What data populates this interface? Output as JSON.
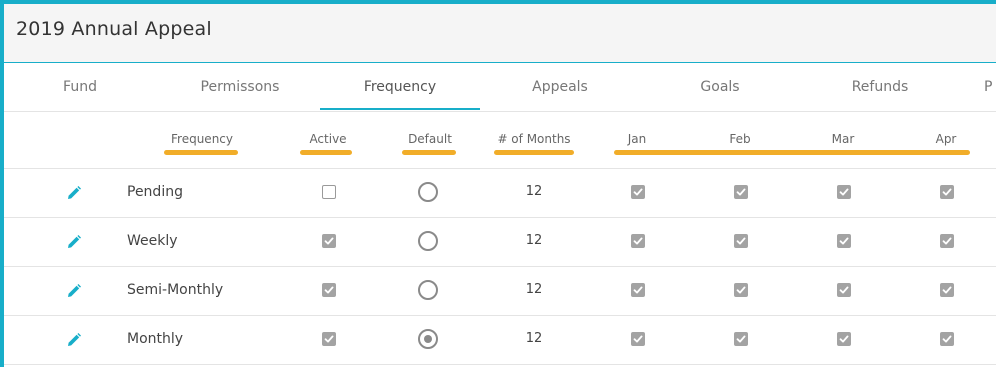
{
  "window": {
    "title": "2019 Annual Appeal"
  },
  "tabs": [
    {
      "label": "Fund"
    },
    {
      "label": "Permissons"
    },
    {
      "label": "Frequency",
      "active": true
    },
    {
      "label": "Appeals"
    },
    {
      "label": "Goals"
    },
    {
      "label": "Refunds"
    },
    {
      "label": "P"
    }
  ],
  "table": {
    "headers": {
      "frequency": "Frequency",
      "active": "Active",
      "default": "Default",
      "months": "# of Months",
      "jan": "Jan",
      "feb": "Feb",
      "mar": "Mar",
      "apr": "Apr"
    },
    "rows": [
      {
        "name": "Pending",
        "active": false,
        "default": false,
        "months": "12",
        "jan": true,
        "feb": true,
        "mar": true,
        "apr": true
      },
      {
        "name": "Weekly",
        "active": true,
        "default": false,
        "months": "12",
        "jan": true,
        "feb": true,
        "mar": true,
        "apr": true
      },
      {
        "name": "Semi-Monthly",
        "active": true,
        "default": false,
        "months": "12",
        "jan": true,
        "feb": true,
        "mar": true,
        "apr": true
      },
      {
        "name": "Monthly",
        "active": true,
        "default": true,
        "months": "12",
        "jan": true,
        "feb": true,
        "mar": true,
        "apr": true
      }
    ]
  },
  "colors": {
    "accent": "#18aec9",
    "highlight": "#f0a91e",
    "checkbox": "#a3a3a3"
  },
  "icons": {
    "edit": "pencil-icon"
  }
}
